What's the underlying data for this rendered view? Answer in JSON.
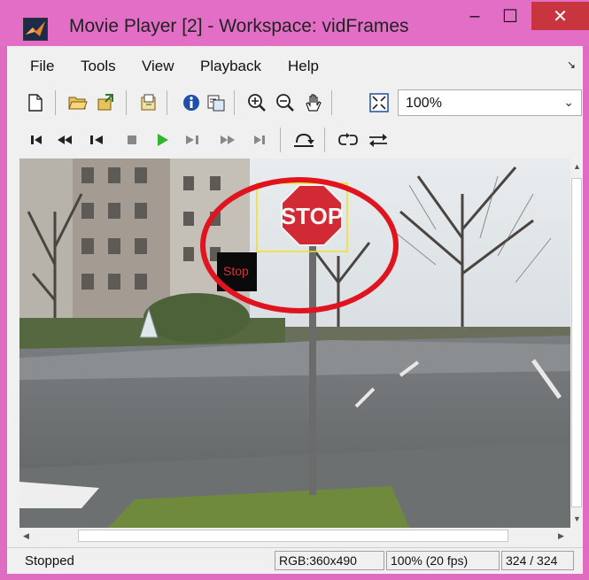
{
  "window": {
    "title": "Movie Player [2] - Workspace: vidFrames",
    "minimize": "–",
    "maximize": "☐",
    "close": "✕"
  },
  "menu": {
    "items": [
      "File",
      "Tools",
      "View",
      "Playback",
      "Help"
    ],
    "overflow_arrow": "↘"
  },
  "toolbar": {
    "icons": [
      "new-document-icon",
      "open-folder-icon",
      "import-icon",
      "export-icon",
      "info-icon",
      "properties-icon",
      "zoom-in-icon",
      "zoom-out-icon",
      "pan-hand-icon",
      "fit-to-window-icon"
    ],
    "zoom_value": "100%"
  },
  "playback": {
    "icons": [
      "first-frame-icon",
      "rewind-icon",
      "step-back-icon",
      "stop-icon",
      "play-icon",
      "step-forward-icon",
      "fast-forward-icon",
      "last-frame-icon",
      "jump-to-icon",
      "loop-icon",
      "autoreverse-icon"
    ],
    "play_color": "#2fb52f"
  },
  "video": {
    "detection_label": "Stop",
    "sign_text": "STOP",
    "highlight_color": "#e0141e",
    "box_color": "#f0e020"
  },
  "status": {
    "state": "Stopped",
    "rgb": "RGB:360x490",
    "zoom_fps": "100% (20 fps)",
    "frame": "324 / 324"
  }
}
